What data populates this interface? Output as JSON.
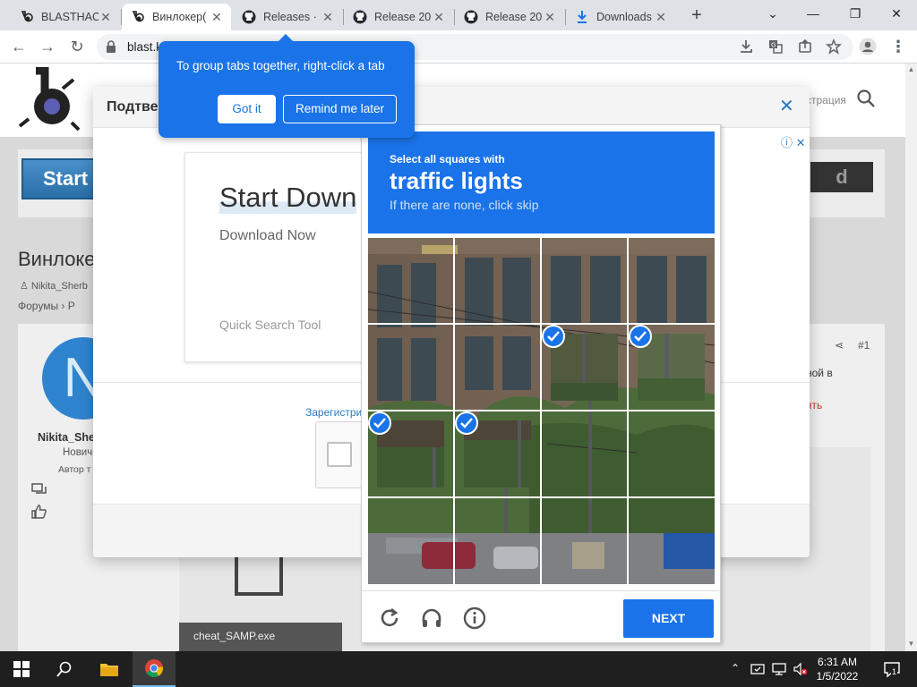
{
  "browser": {
    "tabs": [
      {
        "title": "BLASTHACK",
        "active": false,
        "icon": "blasthack-icon"
      },
      {
        "title": "Винлокер(",
        "active": true,
        "icon": "blasthack-icon"
      },
      {
        "title": "Releases · ",
        "active": false,
        "icon": "github-icon"
      },
      {
        "title": "Release 20",
        "active": false,
        "icon": "github-icon"
      },
      {
        "title": "Release 20",
        "active": false,
        "icon": "github-icon"
      },
      {
        "title": "Downloads",
        "active": false,
        "icon": "download-icon"
      }
    ],
    "url": "blast.k"
  },
  "tip": {
    "text": "To group tabs together, right-click a tab",
    "got_it": "Got it",
    "remind": "Remind me later"
  },
  "site": {
    "register": "страция",
    "start_button": "Start",
    "right_button": "d",
    "thread_title": "Винлоке",
    "author_meta": "Nikita_Sherb",
    "breadcrumb": "Форумы   ›   Р",
    "user_name": "Nikita_She",
    "user_role": "Нович",
    "user_author": "Автор т",
    "post_number": "#1",
    "post_text_1": "ной в",
    "post_text_2": "ять",
    "file_name": "cheat_SAMP.exe"
  },
  "modal": {
    "title": "Подтве",
    "ad_title": "Start Down",
    "ad_subtitle": "Download Now",
    "ad_tool": "Quick Search Tool",
    "register_link": "Зарегистри"
  },
  "recaptcha": {
    "line1": "Select all squares with",
    "line2": "traffic lights",
    "line3": "If there are none, click skip",
    "next_label": "NEXT",
    "selected_tiles": [
      6,
      7,
      8,
      9
    ]
  },
  "taskbar": {
    "time": "6:31 AM",
    "date": "1/5/2022",
    "notification_count": "1"
  },
  "colors": {
    "accent": "#1a73e8",
    "link": "#2a7ac2"
  }
}
